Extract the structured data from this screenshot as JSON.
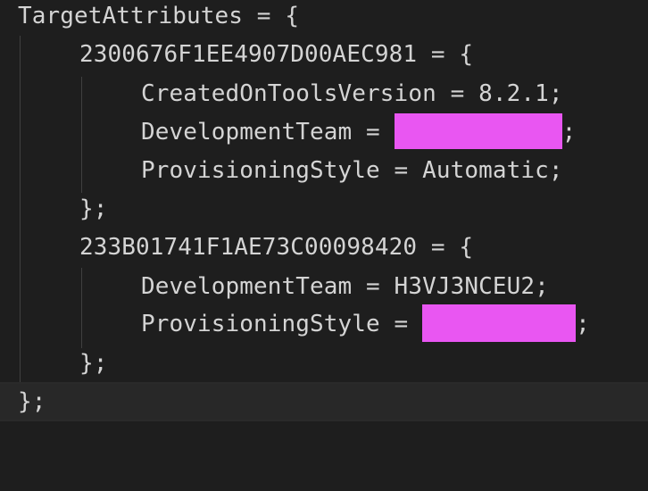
{
  "code": {
    "line1": "TargetAttributes = {",
    "line2": "2300676F1EE4907D00AEC981 = {",
    "line3": "CreatedOnToolsVersion = 8.2.1;",
    "line4_prefix": "DevelopmentTeam = ",
    "line4_suffix": ";",
    "line5": "ProvisioningStyle = Automatic;",
    "line6": "};",
    "line7": "233B01741F1AE73C00098420 = {",
    "line8": "DevelopmentTeam = H3VJ3NCEU2;",
    "line9_prefix": "ProvisioningStyle = ",
    "line9_suffix": ";",
    "line10": "};",
    "line11": "};"
  },
  "redaction_color": "#e956f2"
}
